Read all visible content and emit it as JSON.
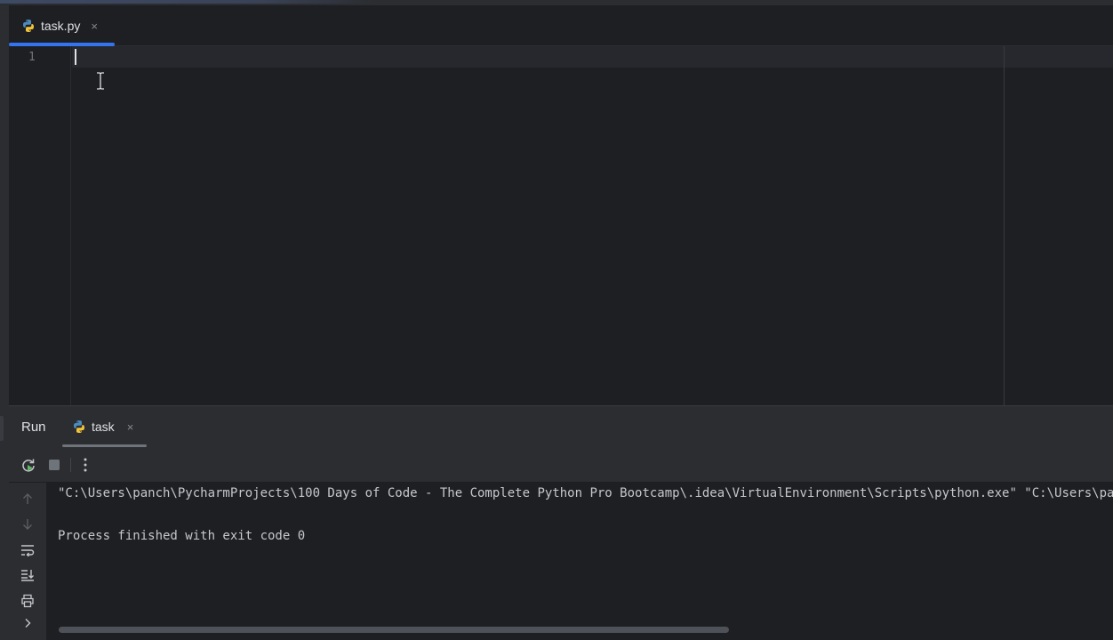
{
  "editor": {
    "tab": {
      "label": "task.py",
      "close": "×",
      "icon": "python-icon"
    },
    "line_numbers": [
      "1"
    ]
  },
  "run": {
    "title": "Run",
    "tab": {
      "label": "task",
      "close": "×",
      "icon": "python-icon"
    },
    "toolbar": [
      "rerun-icon",
      "stop-icon",
      "more-icon"
    ],
    "side_tools": [
      "arrow-up-icon",
      "arrow-down-icon",
      "soft-wrap-icon",
      "scroll-to-end-icon",
      "print-icon",
      "chevron-right-icon"
    ],
    "console": [
      "\"C:\\Users\\panch\\PycharmProjects\\100 Days of Code - The Complete Python Pro Bootcamp\\.idea\\VirtualEnvironment\\Scripts\\python.exe\" \"C:\\Users\\panch\\PycharmProjects\\100 Days of Code - The Complete Python Pro Bootcamp\\task.py\"",
      "",
      "Process finished with exit code 0"
    ]
  },
  "colors": {
    "accent": "#3574f0",
    "background": "#1e1f22",
    "panel": "#2b2d30"
  }
}
